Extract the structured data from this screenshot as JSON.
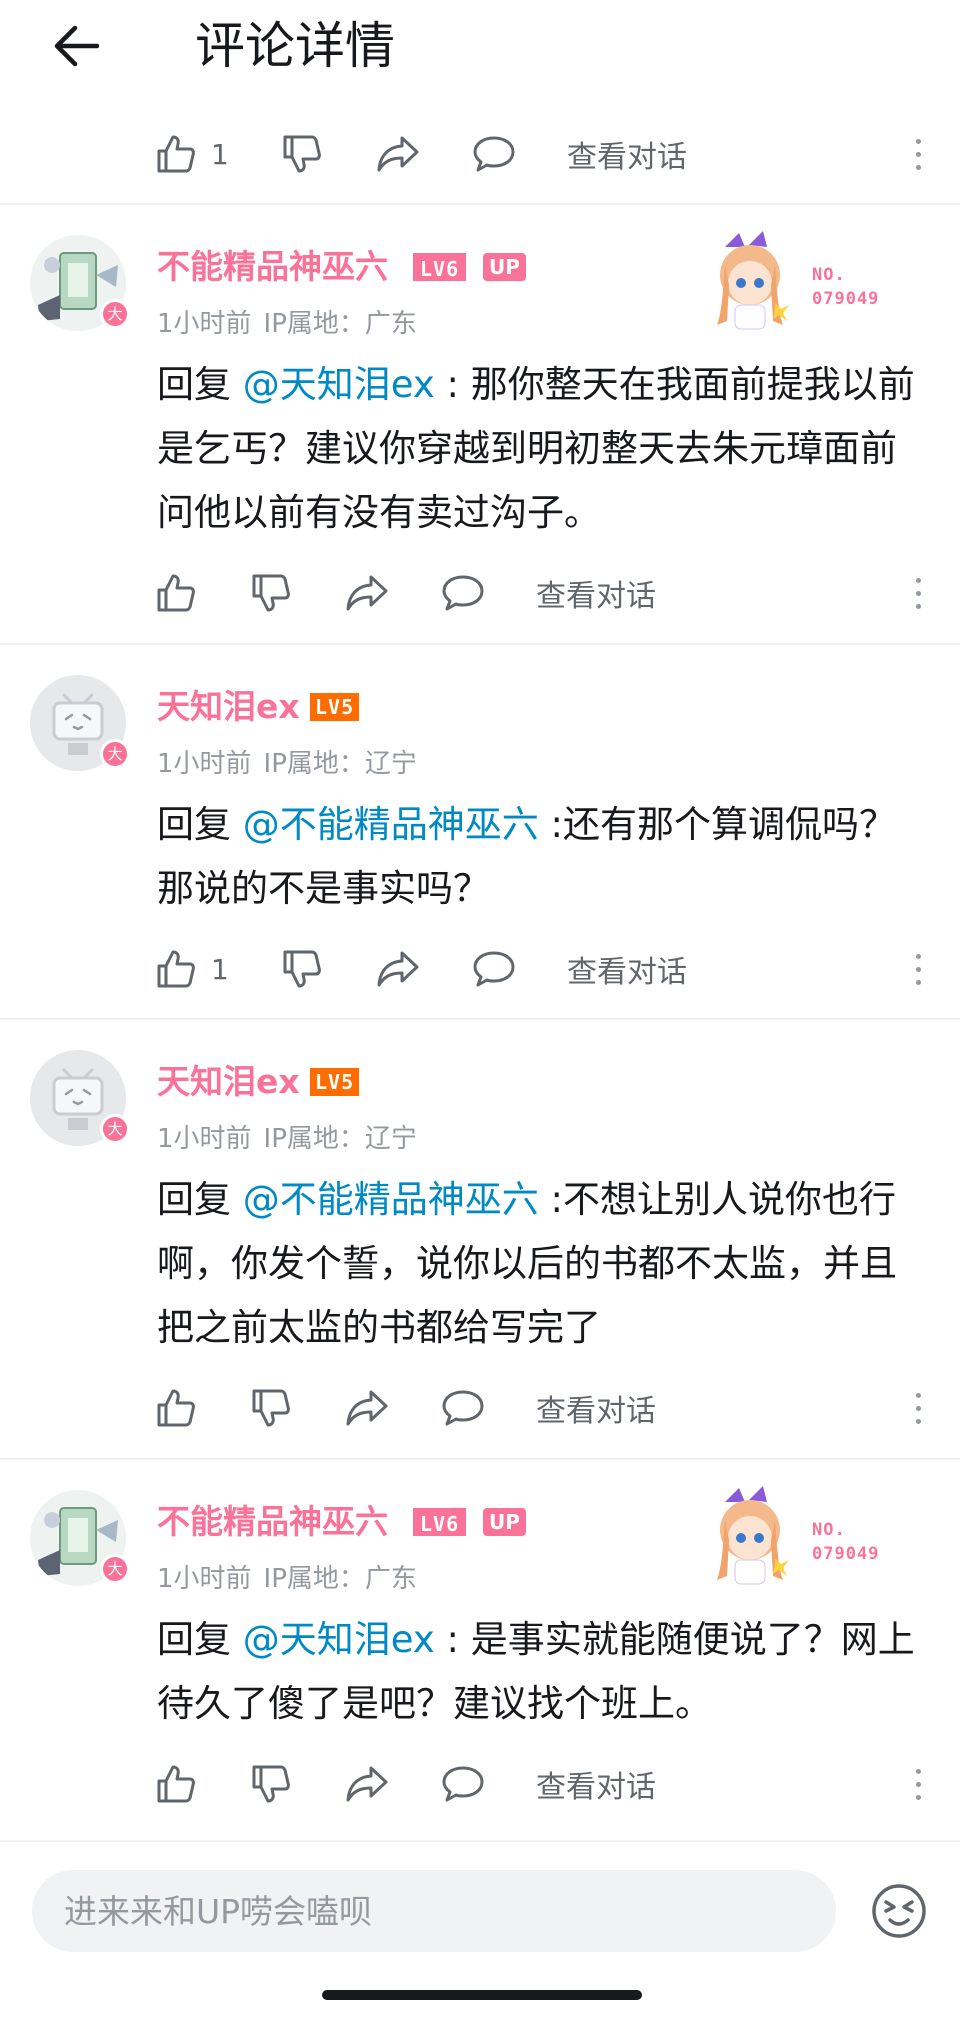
{
  "header": {
    "title": "评论详情",
    "back_icon": "arrow-left-icon"
  },
  "top_actions": {
    "like_count": "1",
    "view_dialog": "查看对话"
  },
  "comments": [
    {
      "user": "不能精品神巫六",
      "level": "LV6",
      "up_tag": "UP",
      "fan_no": "NO.",
      "fan_id": "079049",
      "time": "1小时前",
      "ip": "IP属地：广东",
      "reply_prefix": "回复 ",
      "mention": "@天知泪ex",
      "text": " : 那你整天在我面前提我以前是乞丐？建议你穿越到明初整天去朱元璋面前问他以前有没有卖过沟子。",
      "like_count": "",
      "view_dialog": "查看对话"
    },
    {
      "user": "天知泪ex",
      "level": "LV5",
      "time": "1小时前",
      "ip": "IP属地：辽宁",
      "reply_prefix": "回复 ",
      "mention": "@不能精品神巫六",
      "text": " :还有那个算调侃吗？那说的不是事实吗？",
      "like_count": "1",
      "view_dialog": "查看对话"
    },
    {
      "user": "天知泪ex",
      "level": "LV5",
      "time": "1小时前",
      "ip": "IP属地：辽宁",
      "reply_prefix": "回复 ",
      "mention": "@不能精品神巫六",
      "text": " :不想让别人说你也行啊，你发个誓，说你以后的书都不太监，并且把之前太监的书都给写完了",
      "like_count": "",
      "view_dialog": "查看对话"
    },
    {
      "user": "不能精品神巫六",
      "level": "LV6",
      "up_tag": "UP",
      "fan_no": "NO.",
      "fan_id": "079049",
      "time": "1小时前",
      "ip": "IP属地：广东",
      "reply_prefix": "回复 ",
      "mention": "@天知泪ex",
      "text": " : 是事实就能随便说了？网上待久了傻了是吧？建议找个班上。",
      "like_count": "",
      "view_dialog": "查看对话"
    }
  ],
  "avatar_badge": "大",
  "bottom": {
    "placeholder": "进来来和UP唠会嗑呗",
    "emoji_icon": "emoji-face-icon"
  },
  "colors": {
    "accent": "#fb7299",
    "link": "#008ac5",
    "text": "#18191c",
    "muted": "#9499a0",
    "lv5": "#ff6c00"
  }
}
